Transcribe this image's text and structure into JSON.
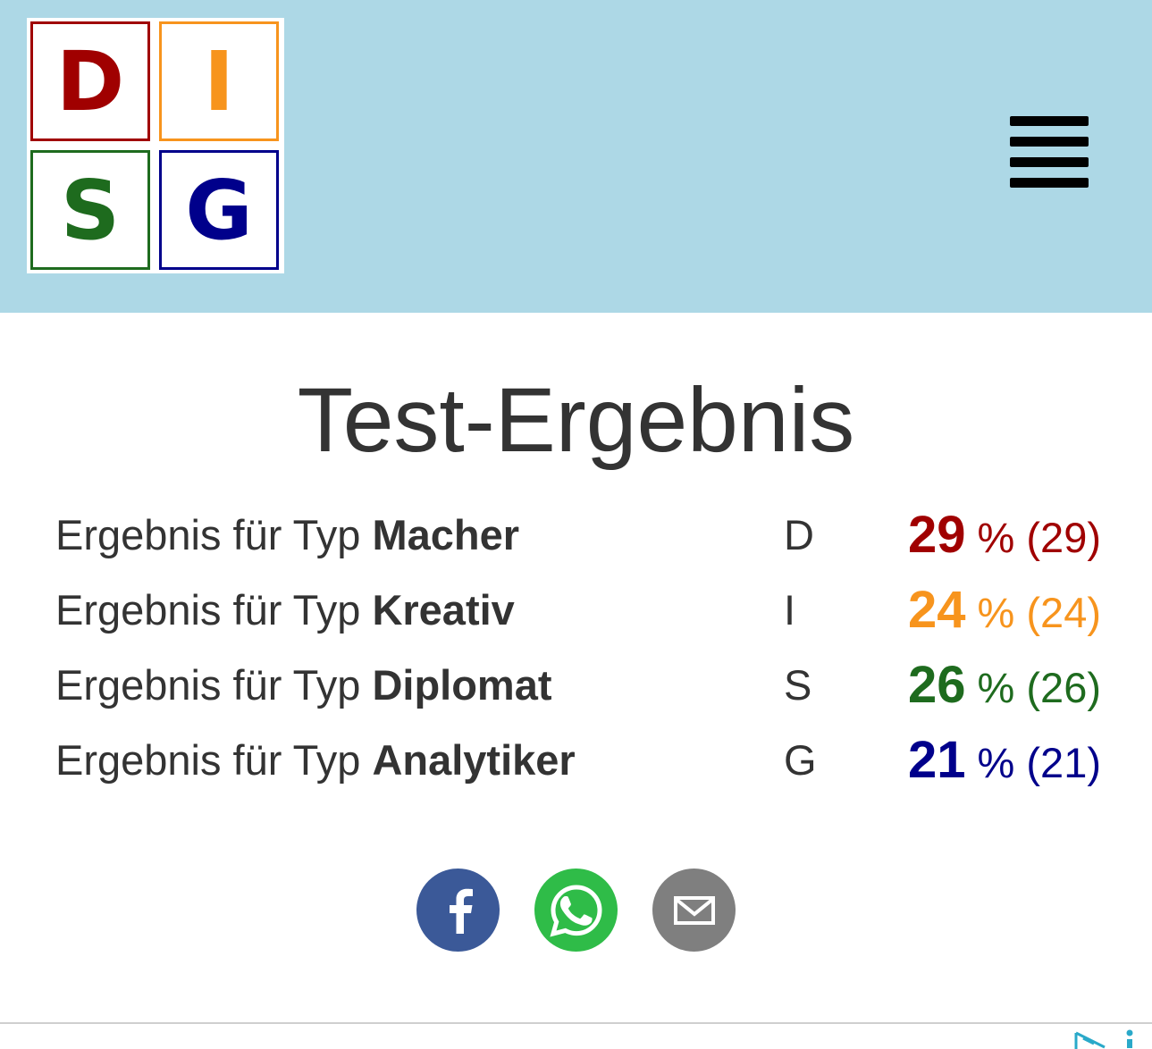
{
  "logo": {
    "letters": [
      "D",
      "I",
      "S",
      "G"
    ],
    "colors": {
      "D": "#a00000",
      "I": "#f7941d",
      "S": "#1e6b1e",
      "G": "#00008b"
    }
  },
  "menu": {
    "icon": "hamburger-menu-icon"
  },
  "page": {
    "title": "Test-Ergebnis"
  },
  "results": [
    {
      "prefix": "Ergebnis für Typ ",
      "type": "Macher",
      "letter": "D",
      "percent": "29",
      "unit": "%",
      "raw": "(29)",
      "color": "#a00000"
    },
    {
      "prefix": "Ergebnis für Typ ",
      "type": "Kreativ",
      "letter": "I",
      "percent": "24",
      "unit": "%",
      "raw": "(24)",
      "color": "#f7941d"
    },
    {
      "prefix": "Ergebnis für Typ ",
      "type": "Diplomat",
      "letter": "S",
      "percent": "26",
      "unit": "%",
      "raw": "(26)",
      "color": "#1e6b1e"
    },
    {
      "prefix": "Ergebnis für Typ ",
      "type": "Analytiker",
      "letter": "G",
      "percent": "21",
      "unit": "%",
      "raw": "(21)",
      "color": "#00008b"
    }
  ],
  "share": [
    {
      "icon": "facebook-icon",
      "color": "#3b5998"
    },
    {
      "icon": "whatsapp-icon",
      "color": "#2fbc48"
    },
    {
      "icon": "email-icon",
      "color": "#7f7f7f"
    }
  ],
  "ad": {
    "icons": [
      "adchoices-icon",
      "info-icon"
    ]
  }
}
